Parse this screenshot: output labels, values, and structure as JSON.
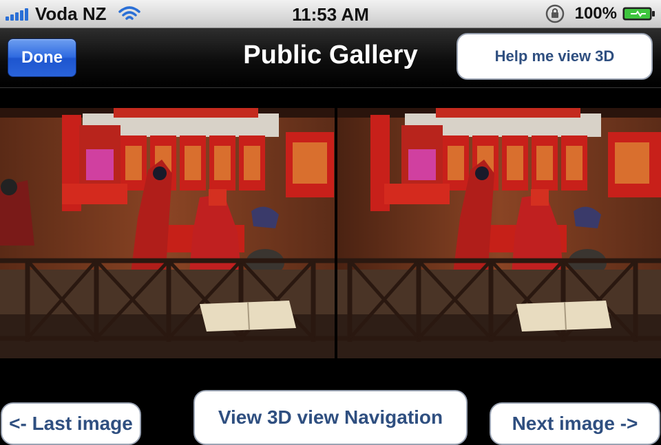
{
  "status_bar": {
    "carrier": "Voda NZ",
    "time": "11:53 AM",
    "battery": "100%",
    "icons": [
      "signal-bars-icon",
      "wifi-icon",
      "rotation-lock-icon",
      "battery-charging-icon"
    ],
    "signal_bars": 5,
    "battery_level": 1.0
  },
  "nav": {
    "done_label": "Done",
    "title": "Public Gallery",
    "help_label": "Help me view 3D"
  },
  "gallery": {
    "layout": "side-by-side stereo pair",
    "colors": {
      "wall": "#7a3a1e",
      "altar_red": "#c8201a",
      "fence": "#3a2418",
      "placard": "#e8dcc0"
    }
  },
  "buttons": {
    "last_label": "<- Last image",
    "view3d_label": "View 3D view Navigation",
    "next_label": "Next image ->"
  },
  "colors": {
    "done_blue": "#2f6ae0",
    "button_text": "#2f4f80",
    "nav_background": "#000000"
  }
}
